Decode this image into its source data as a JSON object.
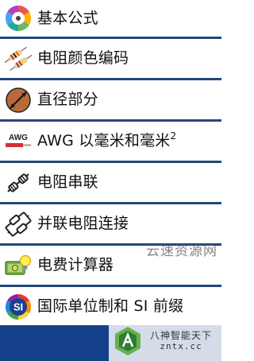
{
  "menu": {
    "items": [
      {
        "label": "基本公式",
        "icon": "formula-wheel-icon"
      },
      {
        "label": "电阻颜色编码",
        "icon": "resistor-color-code-icon"
      },
      {
        "label": "直径部分",
        "icon": "wire-diameter-icon"
      },
      {
        "label": "AWG 以毫米和毫米",
        "superscript": "2",
        "badge": "AWG",
        "icon": "awg-cable-icon"
      },
      {
        "label": "电阻串联",
        "icon": "resistors-series-icon"
      },
      {
        "label": "并联电阻连接",
        "icon": "resistors-parallel-icon"
      },
      {
        "label": "电费计算器",
        "icon": "electricity-bill-calculator-icon"
      },
      {
        "label": "国际单位制和 SI 前缀",
        "badge": "SI",
        "icon": "si-units-icon"
      }
    ]
  },
  "watermark": {
    "site_text": "云速资源网",
    "logo_title": "八神智能天下",
    "logo_url": "zntx.cc"
  },
  "colors": {
    "divider": "#21487c",
    "bottom_bar": "#15408a",
    "text": "#111111"
  }
}
